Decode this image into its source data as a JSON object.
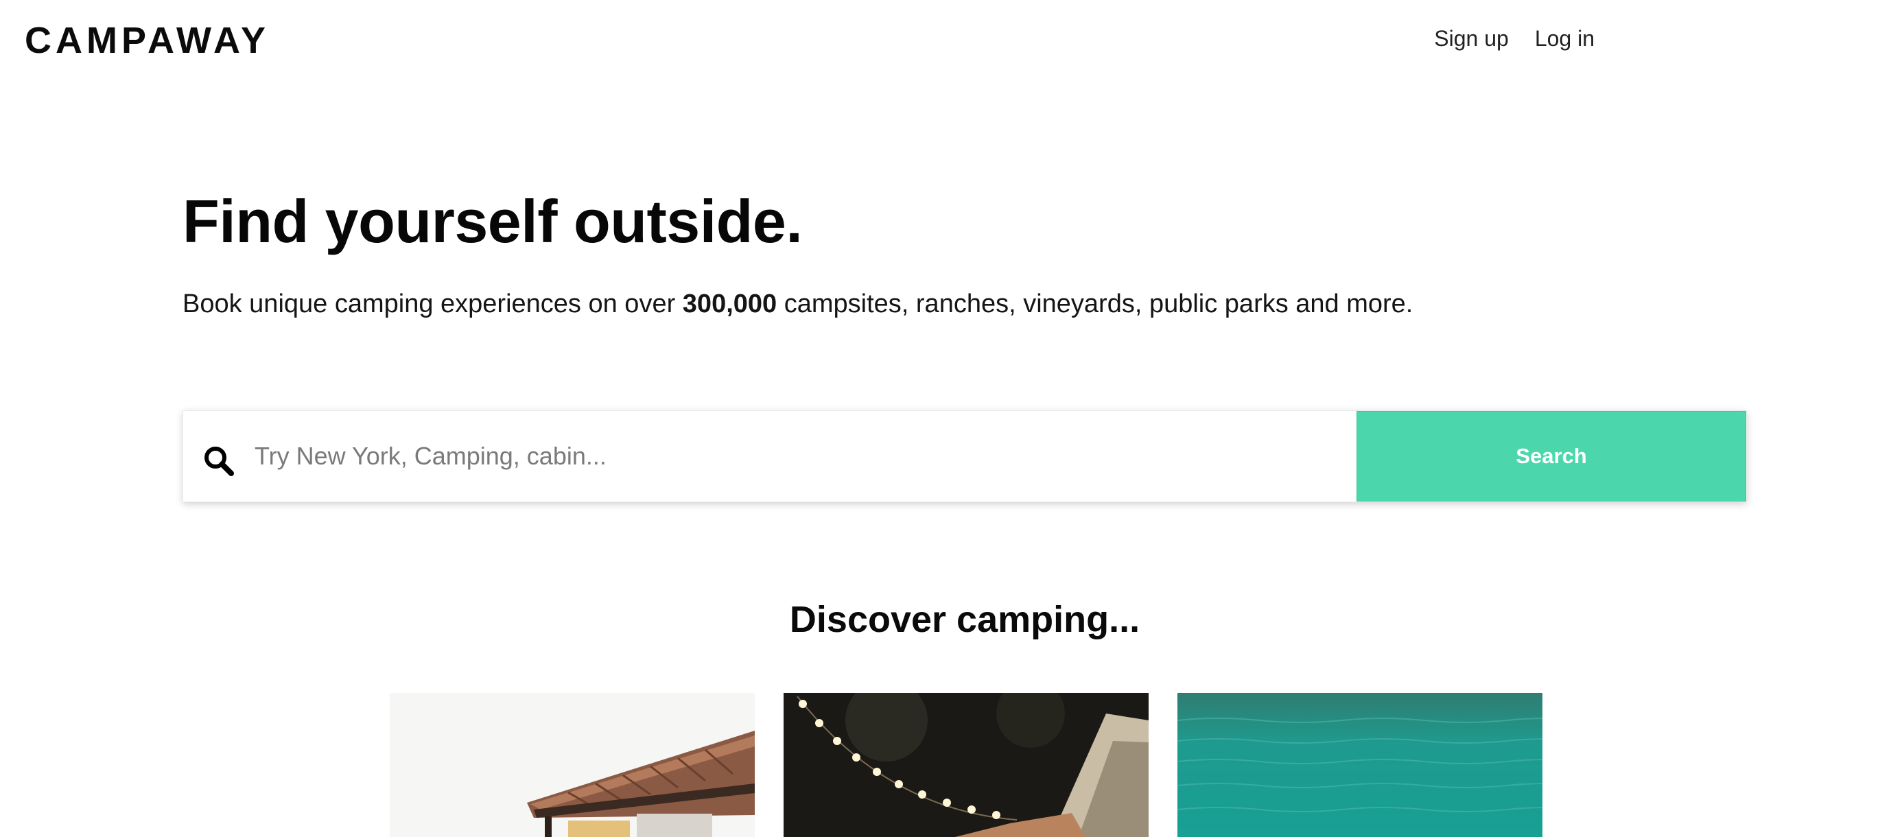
{
  "header": {
    "logo": "CAMPAWAY",
    "nav": {
      "sign_up": "Sign up",
      "log_in": "Log in"
    }
  },
  "hero": {
    "title": "Find yourself outside.",
    "subtitle_before": "Book unique camping experiences on over ",
    "subtitle_bold": "300,000",
    "subtitle_after": " campsites, ranches, vineyards, public parks and more."
  },
  "search": {
    "placeholder": "Try New York, Camping, cabin...",
    "value": "",
    "button_label": "Search",
    "icon": "search-icon"
  },
  "discover": {
    "title": "Discover camping...",
    "cards": [
      {
        "image": "pavilion-roof-photo"
      },
      {
        "image": "string-lights-tent-photo"
      },
      {
        "image": "turquoise-water-photo"
      }
    ]
  },
  "colors": {
    "accent": "#4bd7ab",
    "text": "#111111",
    "background": "#ffffff"
  }
}
